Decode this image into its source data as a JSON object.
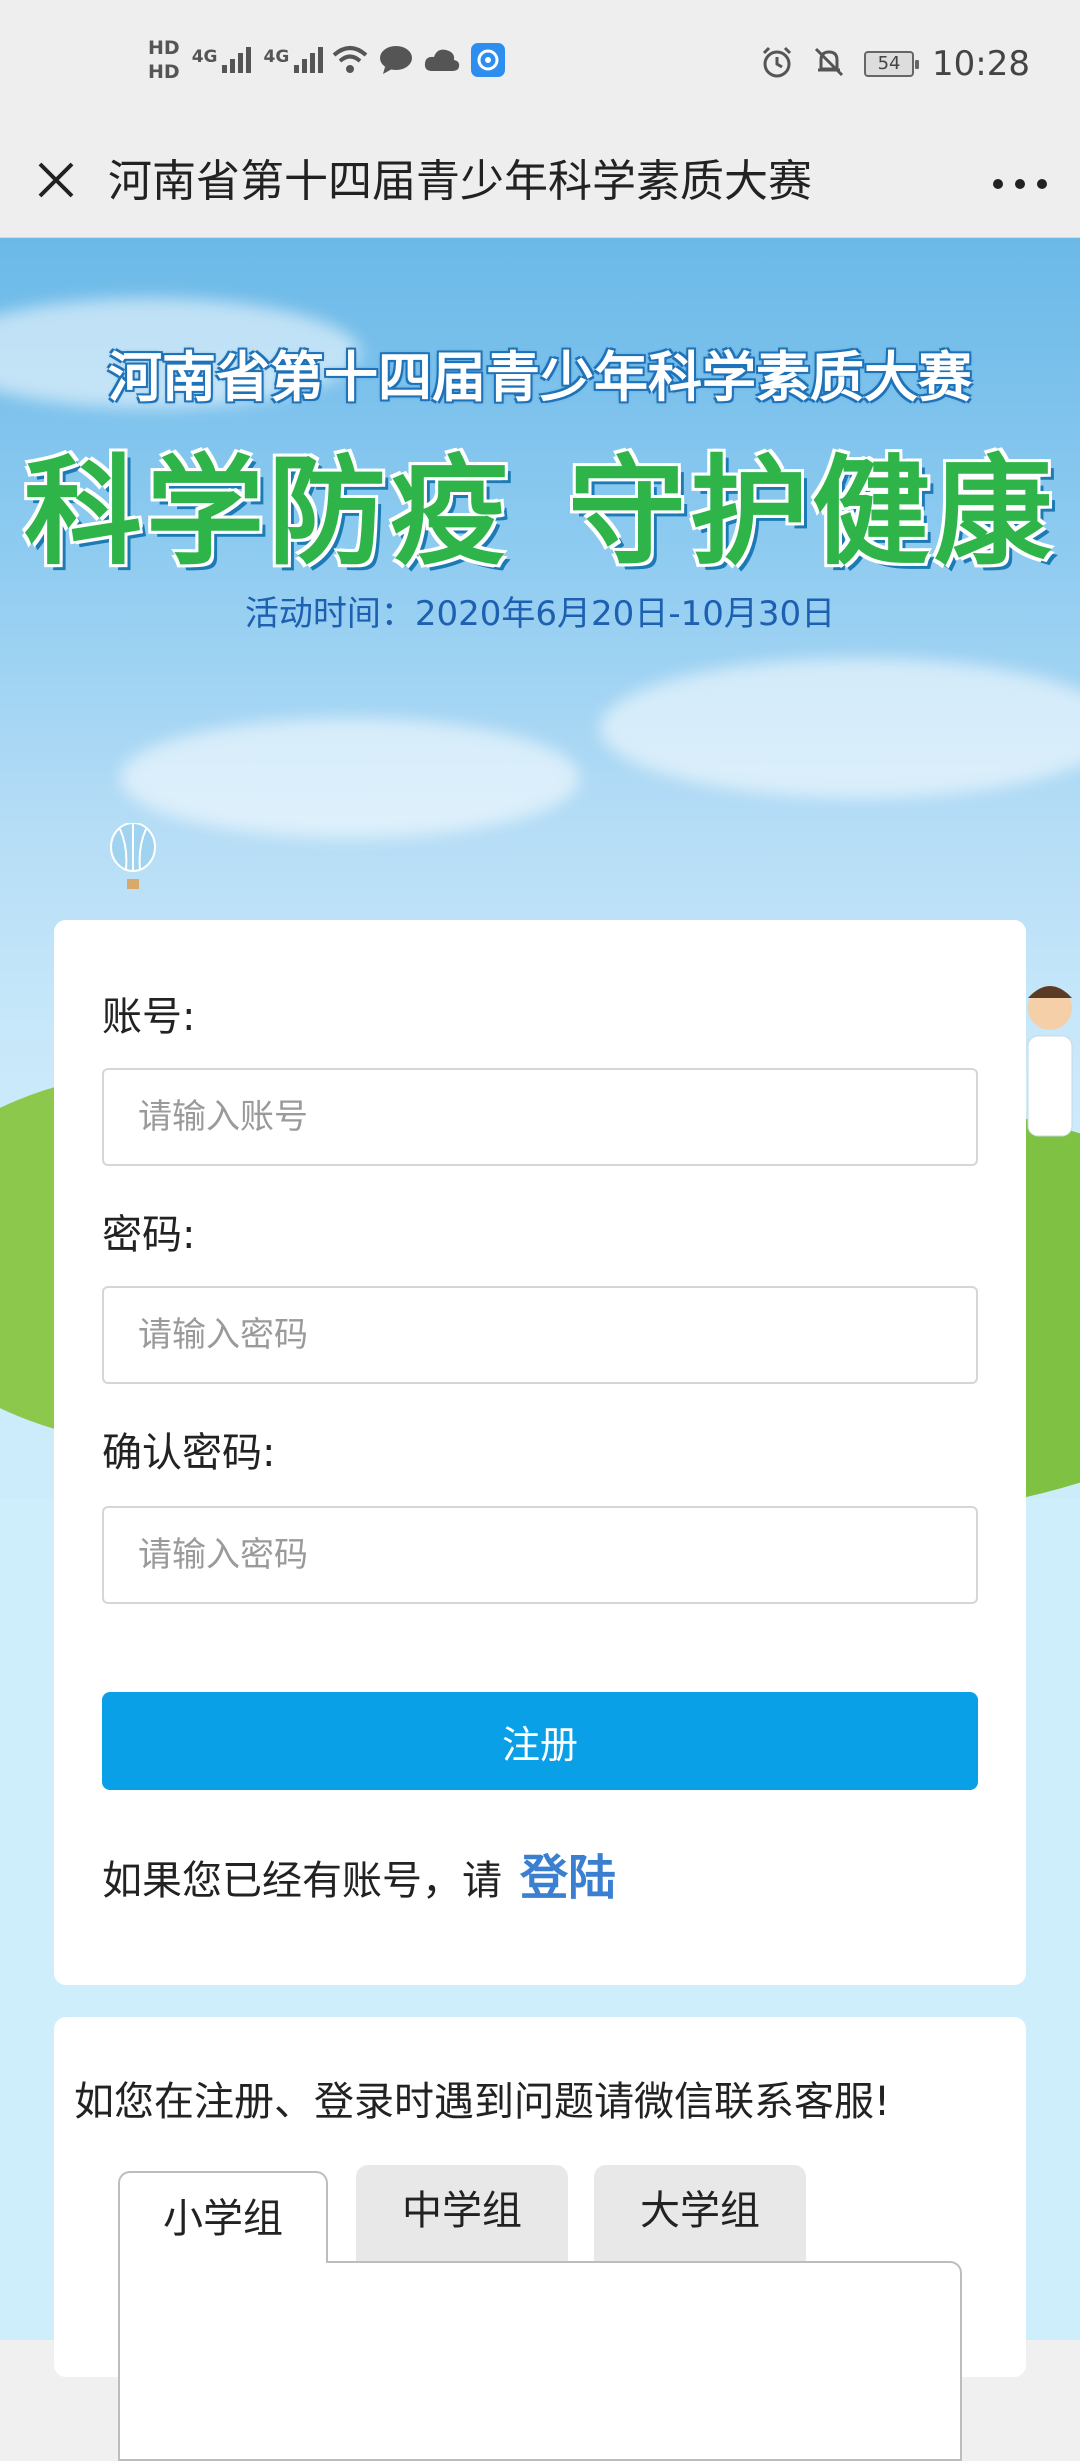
{
  "status_bar": {
    "hd_top": "HD",
    "hd_bottom": "HD",
    "net1": "4G",
    "net2": "4G",
    "battery": "54",
    "time": "10:28"
  },
  "nav": {
    "title": "河南省第十四届青少年科学素质大赛"
  },
  "hero": {
    "title_line1": "河南省第十四届青少年科学素质大赛",
    "slogan_left": "科学防疫",
    "slogan_right": "守护健康",
    "date_text": "活动时间：2020年6月20日-10月30日"
  },
  "form": {
    "account_label": "账号:",
    "account_placeholder": "请输入账号",
    "password_label": "密码:",
    "password_placeholder": "请输入密码",
    "confirm_label": "确认密码:",
    "confirm_placeholder": "请输入密码",
    "register_button": "注册",
    "login_prompt": "如果您已经有账号，请",
    "login_link": "登陆"
  },
  "help": {
    "text": "如您在注册、登录时遇到问题请微信联系客服!",
    "tabs": [
      "小学组",
      "中学组",
      "大学组"
    ],
    "active_tab": "小学组"
  },
  "colors": {
    "accent": "#0aa0e8",
    "link": "#3a7fd0",
    "slogan_green": "#2fb44a"
  }
}
